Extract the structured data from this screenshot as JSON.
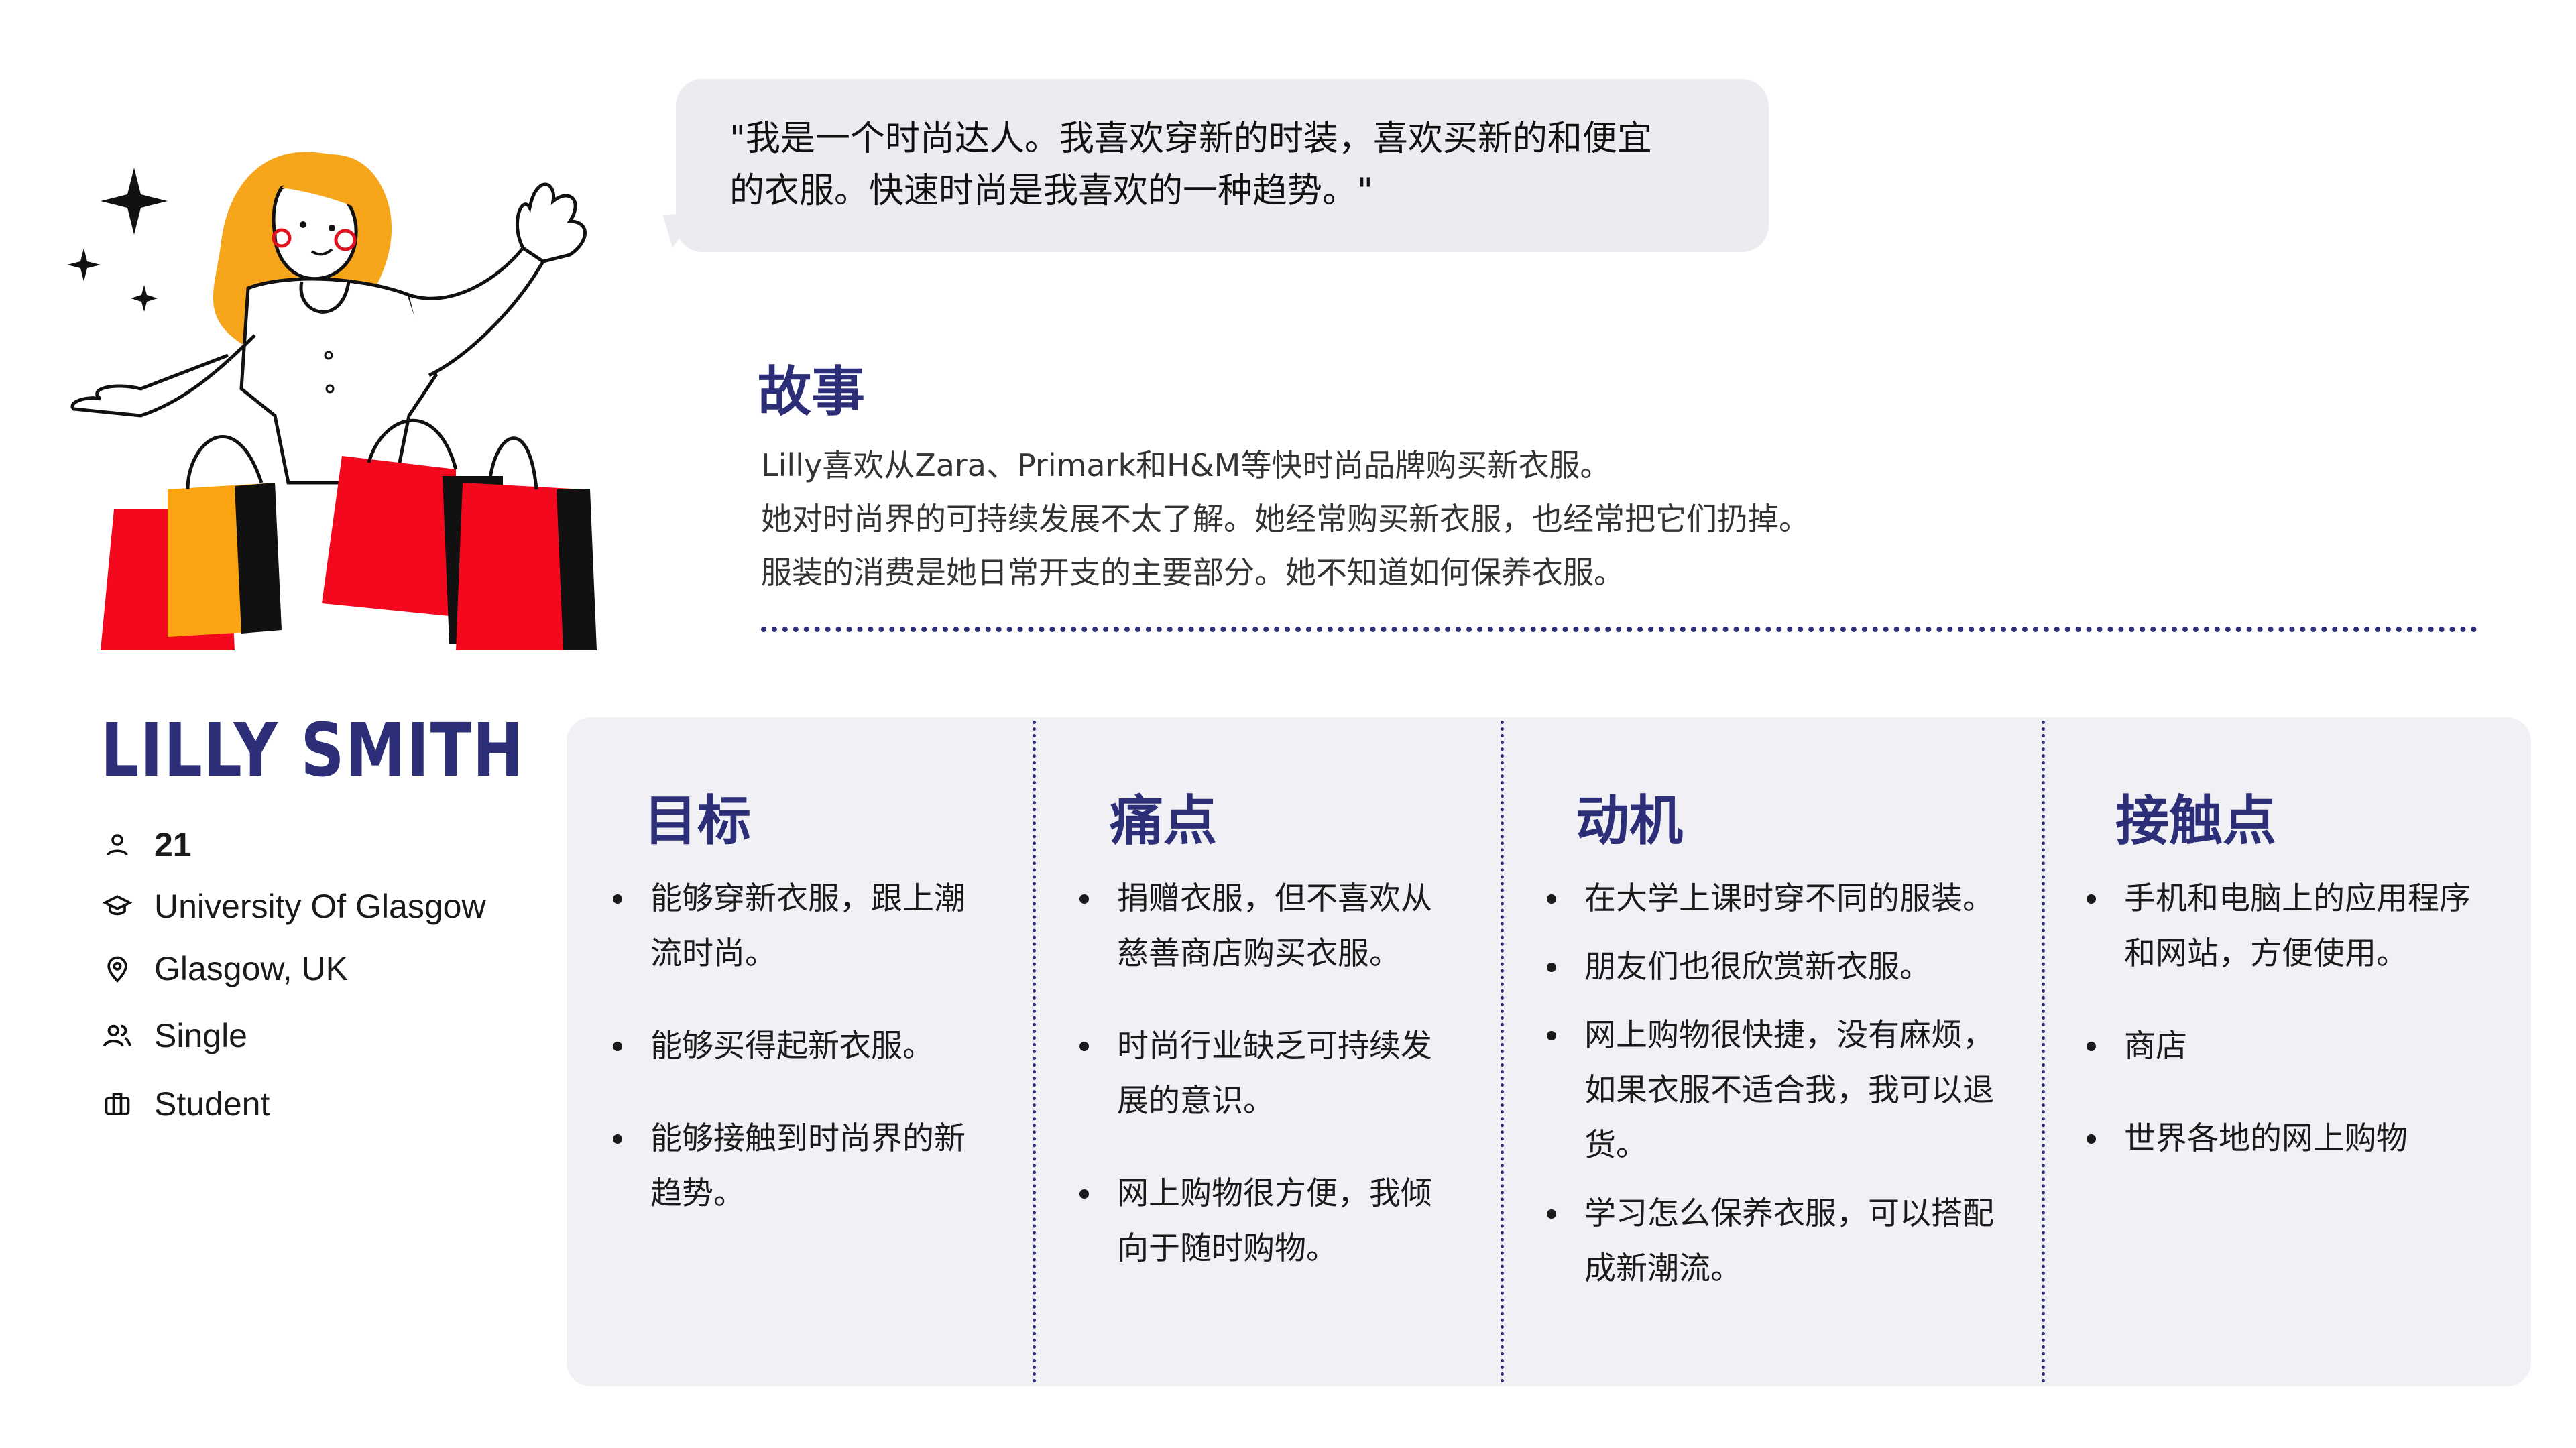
{
  "quote": {
    "line1": "\"我是一个时尚达人。我喜欢穿新的时装，喜欢买新的和便宜",
    "line2": "的衣服。快速时尚是我喜欢的一种趋势。\""
  },
  "story": {
    "title": "故事",
    "lines": [
      "Lilly喜欢从Zara、Primark和H&M等快时尚品牌购买新衣服。",
      "她对时尚界的可持续发展不太了解。她经常购买新衣服，也经常把它们扔掉。",
      "服装的消费是她日常开支的主要部分。她不知道如何保养衣服。"
    ]
  },
  "profile": {
    "name": "LILLY SMITH",
    "age": "21",
    "university": "University Of Glasgow",
    "location": "Glasgow, UK",
    "status": "Single",
    "occupation": "Student",
    "icons": [
      "person-icon",
      "graduation-cap-icon",
      "location-pin-icon",
      "people-icon",
      "briefcase-icon"
    ]
  },
  "columns": [
    {
      "title": "目标",
      "items": [
        [
          "能够穿新衣服，跟上潮",
          "流时尚。"
        ],
        [
          "能够买得起新衣服。"
        ],
        [
          "能够接触到时尚界的新",
          "趋势。"
        ]
      ]
    },
    {
      "title": "痛点",
      "items": [
        [
          "捐赠衣服，但不喜欢从",
          "慈善商店购买衣服。"
        ],
        [
          "时尚行业缺乏可持续发",
          "展的意识。"
        ],
        [
          "网上购物很方便，我倾",
          "向于随时购物。"
        ]
      ]
    },
    {
      "title": "动机",
      "items": [
        [
          "在大学上课时穿不同的服装。"
        ],
        [
          "朋友们也很欣赏新衣服。"
        ],
        [
          "网上购物很快捷，没有麻烦，",
          "如果衣服不适合我，我可以退",
          "货。"
        ],
        [
          "学习怎么保养衣服，可以搭配",
          "成新潮流。"
        ]
      ]
    },
    {
      "title": "接触点",
      "items": [
        [
          "手机和电脑上的应用程序",
          "和网站，方便使用。"
        ],
        [
          "商店"
        ],
        [
          "世界各地的网上购物"
        ]
      ]
    }
  ],
  "colors": {
    "accent": "#2c2f78",
    "card_bg": "#f0f0f5",
    "bubble_bg": "#ebebf0",
    "hair": "#f7a51b",
    "bag_red": "#f3081e",
    "bag_orange": "#fca311"
  }
}
